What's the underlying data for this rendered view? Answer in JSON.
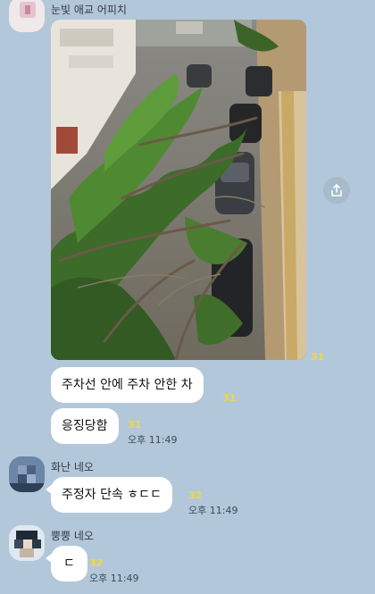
{
  "colors": {
    "background": "#b2c7d9",
    "bubble": "#ffffff",
    "unread": "#f2d83a"
  },
  "messages": [
    {
      "sender": "눈빛 애교 어피치",
      "photo_unread": "31",
      "text_1": "주차선 안에 주차 안한 차",
      "text_1_unread": "31",
      "text_2": "응징당함",
      "text_2_unread": "31",
      "time": "오후 11:49"
    },
    {
      "sender": "화난 네오",
      "text": "주정자 단속 ㅎㄷㄷ",
      "unread": "32",
      "time": "오후 11:49"
    },
    {
      "sender": "뿡뿡 네오",
      "text": "ㄷ",
      "unread": "32",
      "time": "오후 11:49"
    }
  ],
  "icons": {
    "share": "share-icon"
  }
}
